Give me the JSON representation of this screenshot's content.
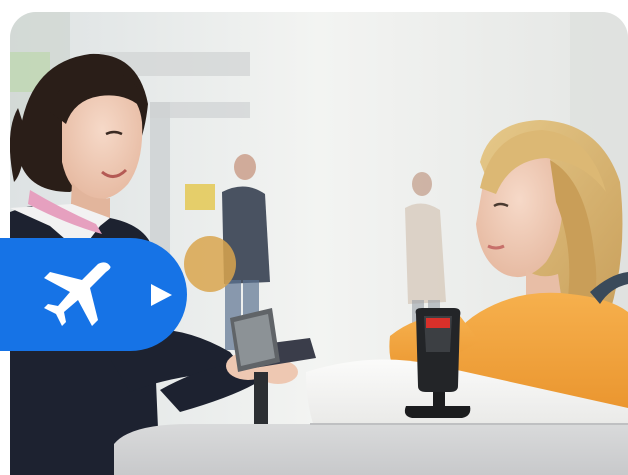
{
  "photo": {
    "scene": "airport-check-in-counter"
  },
  "badge": {
    "icon": "airplane-icon",
    "action_icon": "play-icon"
  },
  "colors": {
    "badge_blue": "#1673e6",
    "icon_white": "#ffffff",
    "scanner_red": "#d8302a",
    "jacket_orange": "#f2a23c",
    "uniform_navy": "#1d2230",
    "scarf_pink": "#e6a0bf",
    "counter_white": "#f4f4f2"
  }
}
